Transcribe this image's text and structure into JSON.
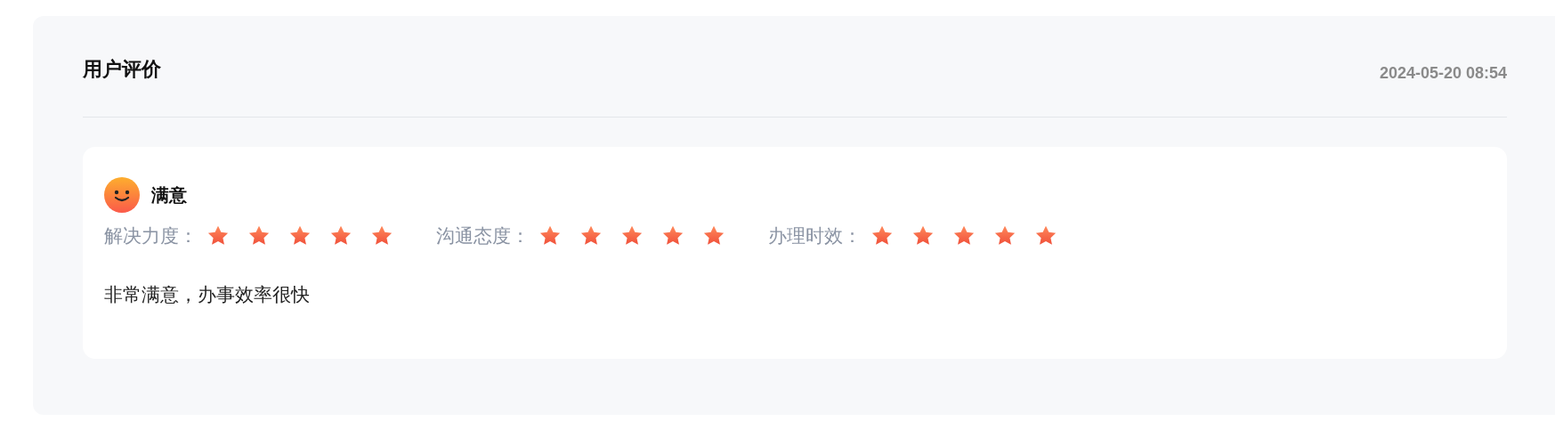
{
  "header": {
    "title": "用户评价",
    "time": "2024-05-20 08:54"
  },
  "review": {
    "mood": "满意",
    "ratings": [
      {
        "label": "解决力度：",
        "stars": 5
      },
      {
        "label": "沟通态度：",
        "stars": 5
      },
      {
        "label": "办理时效：",
        "stars": 5
      }
    ],
    "comment": "非常满意，办事效率很快"
  }
}
